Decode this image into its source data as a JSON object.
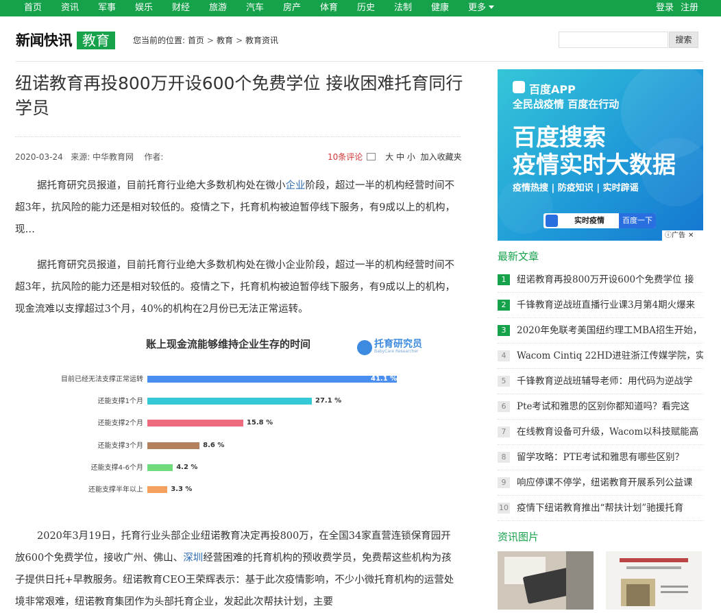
{
  "nav": {
    "items": [
      "首页",
      "资讯",
      "军事",
      "娱乐",
      "财经",
      "旅游",
      "汽车",
      "房产",
      "体育",
      "历史",
      "法制",
      "健康"
    ],
    "more": "更多",
    "login": "登录",
    "register": "注册"
  },
  "header": {
    "logo_text": "新闻快讯",
    "logo_tag": "教育",
    "breadcrumb_prefix": "您当前的位置:",
    "breadcrumb": [
      "首页",
      "教育",
      "教育资讯"
    ],
    "search_placeholder": "",
    "search_button": "搜索"
  },
  "article": {
    "title": "纽诺教育再投800万开设600个免费学位 接收困难托育同行学员",
    "date": "2020-03-24",
    "source": "来源: 中华教育网",
    "author": "作者:",
    "comments": "10条评论",
    "font_sizes": "大 中 小",
    "favorite": "加入收藏夹",
    "p1_a": "据托育研究员报道，目前托育行业绝大多数机构处在微小",
    "p1_link": "企业",
    "p1_b": "阶段，超过一半的机构经营时间不超3年，抗风险的能力还是相对较低的。疫情之下，托育机构被迫暂停线下服务，有9成以上的机构，现…",
    "p2": "据托育研究员报道，目前托育行业绝大多数机构处在微小企业阶段，超过一半的机构经营时间不超3年，抗风险的能力还是相对较低的。疫情之下，托育机构被迫暂停线下服务，有9成以上的机构，现金流难以支撑超过3个月，40%的机构在2月份已无法正常运转。",
    "p3_a": "2020年3月19日，托育行业头部企业纽诺教育决定再投800万，在全国34家直营连锁保育园开放600个免费学位，接收广州、佛山、",
    "p3_link": "深圳",
    "p3_b": "经营困难的托育机构的预收费学员，免费帮这些机构为孩子提供日托+早教服务。纽诺教育CEO王荣辉表示：基于此次疫情影响，不少小微托育机构的运营处境非常艰难，纽诺教育集团作为头部托育企业，发起此次帮扶计划，主要"
  },
  "chart_data": {
    "type": "bar",
    "title": "账上现金流能够维持企业生存的时间",
    "logo": "托育研究员",
    "logo_sub": "BabyCare Researcher",
    "categories": [
      "目前已经无法支撑正常运转",
      "还能支撑1个月",
      "还能支撑2个月",
      "还能支撑3个月",
      "还能支撑4-6个月",
      "还能支撑半年以上"
    ],
    "values": [
      41.1,
      27.1,
      15.8,
      8.6,
      4.2,
      3.3
    ],
    "value_labels": [
      "41.1 %",
      "27.1 %",
      "15.8 %",
      "8.6 %",
      "4.2 %",
      "3.3 %"
    ],
    "colors": [
      "#4a8ef0",
      "#35c9d8",
      "#ee6a7e",
      "#b5805e",
      "#6fdb7a",
      "#f4a05e"
    ],
    "xlim": [
      0,
      45
    ]
  },
  "sidebar": {
    "ad": {
      "brand": "百度APP",
      "slogan": "全民战疫情 百度在行动",
      "headline1": "百度搜索",
      "headline2": "疫情实时大数据",
      "tags": "疫情热搜 | 防疫知识 | 实时辟谣",
      "search_text": "实时疫情",
      "search_button": "百度一下",
      "ad_label": "广告"
    },
    "latest_title": "最新文章",
    "latest": [
      "纽诺教育再投800万开设600个免费学位 接",
      "千锋教育逆战班直播行业课3月第4期火爆来",
      "2020年免联考美国纽约理工MBA招生开始，",
      "Wacom Cintiq 22HD进驻浙江传媒学院，实",
      "千锋教育逆战班辅导老师：用代码为逆战学",
      "Pte考试和雅思的区别你都知道吗？看完这",
      "在线教育设备可升级，Wacom以科技赋能高",
      "留学攻略：PTE考试和雅思有哪些区别？",
      "响应停课不停学，纽诺教育开展系列公益课",
      "疫情下纽诺教育推出“帮扶计划”驰援托育"
    ],
    "ranks": [
      "1",
      "2",
      "3",
      "4",
      "5",
      "6",
      "7",
      "8",
      "9",
      "10"
    ],
    "pictures_title": "资讯图片"
  }
}
